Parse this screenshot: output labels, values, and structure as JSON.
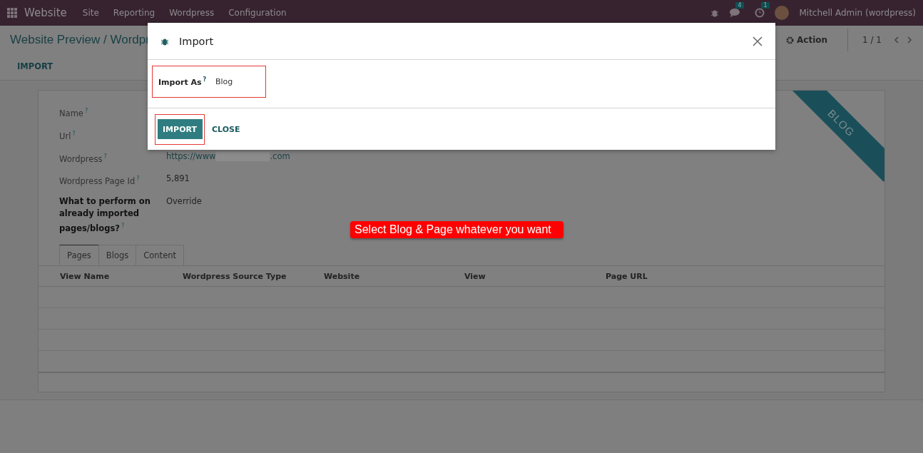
{
  "navbar": {
    "app_name": "Website",
    "menu": [
      "Site",
      "Reporting",
      "Wordpress",
      "Configuration"
    ],
    "messages_count": "4",
    "activities_count": "1",
    "user": "Mitchell Admin (wordpress)"
  },
  "control_panel": {
    "breadcrumb": "Website Preview / Wordpr",
    "action": "Action",
    "pager": "1 / 1",
    "button": "IMPORT"
  },
  "form": {
    "ribbon": "BLOG",
    "fields": [
      {
        "label": "Name$^{?}$",
        "kind": "plain"
      },
      {
        "label": "Url$^{?}$",
        "kind": "plain"
      },
      {
        "label": "Wordpress$^{?}$",
        "kind": "link",
        "value_start": "https://www",
        "value_end": ".com"
      },
      {
        "label": "Wordpress Page Id$^{?}$",
        "kind": "text",
        "value": "5,891"
      },
      {
        "label": "**What to perform on already imported pages/blogs?**$^{?}$",
        "kind": "text",
        "value": "Override"
      }
    ],
    "tabs": [
      {
        "label": "Pages",
        "selected": true
      },
      {
        "label": "Blogs",
        "selected": false
      },
      {
        "label": "Content",
        "selected": false
      }
    ],
    "table": {
      "columns": [
        "View Name",
        "Wordpress Source Type",
        "Website",
        "View",
        "Page URL"
      ]
    }
  },
  "dialog": {
    "title": "Import",
    "field_label": "Import As$^{?}$",
    "field_value": "Blog",
    "buttons": [
      {
        "label": "IMPORT",
        "kind": "primary"
      },
      {
        "label": "CLOSE",
        "kind": "link"
      }
    ]
  },
  "callout": "Select Blog & Page whatever you want"
}
